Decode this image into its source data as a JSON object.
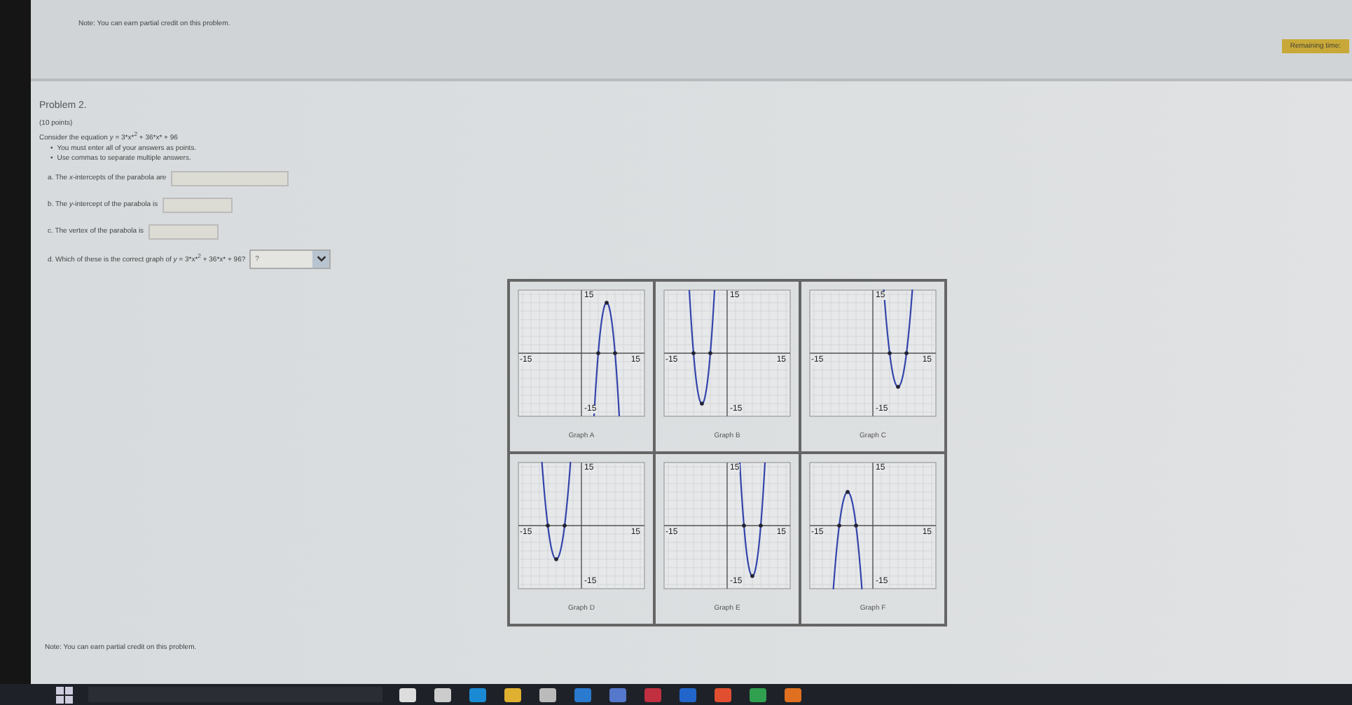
{
  "top_note": "Note: You can earn partial credit on this problem.",
  "timer": {
    "label": "Remaining time:"
  },
  "problem": {
    "title": "Problem 2.",
    "points": "(10 points)",
    "statement": "Consider the equation *y* = 3*x*$^{2}$ + 36*x* + 96",
    "bullets": [
      {
        "marker": "•",
        "text": "You must enter all of your answers as points."
      },
      {
        "marker": "•",
        "text": "Use commas to separate multiple answers."
      }
    ],
    "questions": [
      {
        "kind": "field",
        "label": "a. The *x*-intercepts of the parabola are"
      },
      {
        "kind": "field",
        "label": "b. The *y*-intercept of the parabola is"
      },
      {
        "kind": "field",
        "label": "c. The vertex of the parabola is"
      },
      {
        "kind": "select",
        "label": "d. Which of these is the correct graph of *y* = 3*x*$^{2}$ + 36*x* + 96?",
        "value": "?"
      }
    ]
  },
  "graphs": [
    {
      "caption": "Graph A",
      "x_min": "-15",
      "x_max": "15",
      "y_max": "15",
      "y_min": "-15"
    },
    {
      "caption": "Graph B",
      "x_min": "-15",
      "x_max": "15",
      "y_max": "15",
      "y_min": "-15"
    },
    {
      "caption": "Graph C",
      "x_min": "-15",
      "x_max": "15",
      "y_max": "15",
      "y_min": "-15"
    },
    {
      "caption": "Graph D",
      "x_min": "-15",
      "x_max": "15",
      "y_max": "15",
      "y_min": "-15"
    },
    {
      "caption": "Graph E",
      "x_min": "-15",
      "x_max": "15",
      "y_max": "15",
      "y_min": "-15"
    },
    {
      "caption": "Graph F",
      "x_min": "-15",
      "x_max": "15",
      "y_max": "15",
      "y_min": "-15"
    }
  ],
  "bottom_note": "Note: You can earn partial credit on this problem."
}
